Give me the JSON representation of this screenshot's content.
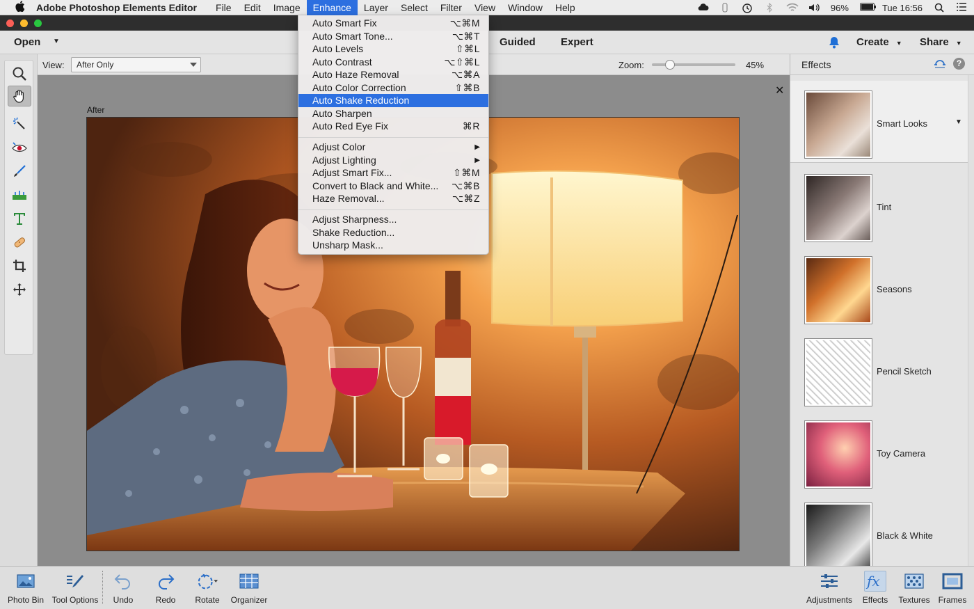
{
  "menubar": {
    "app_name": "Adobe Photoshop Elements Editor",
    "items": [
      "File",
      "Edit",
      "Image",
      "Enhance",
      "Layer",
      "Select",
      "Filter",
      "View",
      "Window",
      "Help"
    ],
    "active_item": "Enhance",
    "battery": "96%",
    "clock": "Tue 16:56"
  },
  "header": {
    "open_label": "Open",
    "modes": [
      "Guided",
      "Expert"
    ],
    "create_label": "Create",
    "share_label": "Share"
  },
  "options": {
    "view_label": "View:",
    "view_value": "After Only",
    "zoom_label": "Zoom:",
    "zoom_value": "45%",
    "zoom_fraction": 0.18
  },
  "canvas": {
    "view_caption": "After"
  },
  "enhance_menu": {
    "groups": [
      [
        {
          "label": "Auto Smart Fix",
          "shortcut": "⌥⌘M"
        },
        {
          "label": "Auto Smart Tone...",
          "shortcut": "⌥⌘T"
        },
        {
          "label": "Auto Levels",
          "shortcut": "⇧⌘L"
        },
        {
          "label": "Auto Contrast",
          "shortcut": "⌥⇧⌘L"
        },
        {
          "label": "Auto Haze Removal",
          "shortcut": "⌥⌘A"
        },
        {
          "label": "Auto Color Correction",
          "shortcut": "⇧⌘B"
        },
        {
          "label": "Auto Shake Reduction",
          "shortcut": "",
          "highlighted": true
        },
        {
          "label": "Auto Sharpen",
          "shortcut": ""
        },
        {
          "label": "Auto Red Eye Fix",
          "shortcut": "⌘R"
        }
      ],
      [
        {
          "label": "Adjust Color",
          "submenu": true
        },
        {
          "label": "Adjust Lighting",
          "submenu": true
        },
        {
          "label": "Adjust Smart Fix...",
          "shortcut": "⇧⌘M"
        },
        {
          "label": "Convert to Black and White...",
          "shortcut": "⌥⌘B"
        },
        {
          "label": "Haze Removal...",
          "shortcut": "⌥⌘Z"
        }
      ],
      [
        {
          "label": "Adjust Sharpness...",
          "shortcut": ""
        },
        {
          "label": "Shake Reduction...",
          "shortcut": ""
        },
        {
          "label": "Unsharp Mask...",
          "shortcut": ""
        }
      ]
    ]
  },
  "effects_panel": {
    "title": "Effects",
    "items": [
      {
        "label": "Smart Looks",
        "style": "color"
      },
      {
        "label": "Tint",
        "style": "tint"
      },
      {
        "label": "Seasons",
        "style": "warm"
      },
      {
        "label": "Pencil Sketch",
        "style": "sketch"
      },
      {
        "label": "Toy Camera",
        "style": "toy"
      },
      {
        "label": "Black & White",
        "style": "bw"
      }
    ]
  },
  "bottombar": {
    "left": [
      {
        "label": "Photo Bin",
        "icon": "photo-bin-icon"
      },
      {
        "label": "Tool Options",
        "icon": "tool-options-icon"
      },
      {
        "label": "Undo",
        "icon": "undo-icon"
      },
      {
        "label": "Redo",
        "icon": "redo-icon"
      },
      {
        "label": "Rotate",
        "icon": "rotate-icon"
      },
      {
        "label": "Organizer",
        "icon": "organizer-icon"
      }
    ],
    "right": [
      {
        "label": "Adjustments",
        "icon": "adjustments-icon"
      },
      {
        "label": "Effects",
        "icon": "fx-icon",
        "active": true
      },
      {
        "label": "Textures",
        "icon": "textures-icon"
      },
      {
        "label": "Frames",
        "icon": "frames-icon"
      }
    ]
  },
  "tools": [
    "zoom-icon",
    "hand-icon",
    "quick-selection-icon",
    "red-eye-icon",
    "brush-icon",
    "straighten-icon",
    "type-icon",
    "spot-healing-icon",
    "crop-icon",
    "move-icon"
  ],
  "colors": {
    "accent": "#2c6fe0",
    "panel_bg": "#e4e4e4",
    "canvas_bg": "#8c8c8c"
  }
}
